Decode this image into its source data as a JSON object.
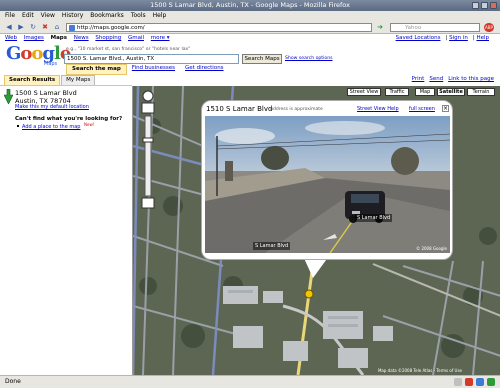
{
  "window": {
    "title": "1500 S Lamar Blvd, Austin, TX - Google Maps - Mozilla Firefox"
  },
  "menu": [
    "File",
    "Edit",
    "View",
    "History",
    "Bookmarks",
    "Tools",
    "Help"
  ],
  "browser": {
    "url": "http://maps.google.com/",
    "search_placeholder": "Yahoo",
    "status": "Done"
  },
  "gtoolbar": {
    "links": [
      "Web",
      "Images",
      "Maps",
      "News",
      "Shopping",
      "Gmail",
      "more ▾"
    ],
    "right": [
      "Saved Locations",
      "Sign in",
      "Help"
    ]
  },
  "logo": {
    "g1": "G",
    "o1": "o",
    "o2": "o",
    "g2": "g",
    "l": "l",
    "e": "e",
    "sub": "Maps"
  },
  "search": {
    "hint": "e.g., \"10 market st, san francisco\" or \"hotels near lax\"",
    "value": "1500 S. Lamar Blvd., Austin, TX",
    "button": "Search Maps",
    "options": "Show search options",
    "tabs": [
      "Search the map",
      "Find businesses",
      "Get directions"
    ]
  },
  "left_tabs": [
    "Search Results",
    "My Maps"
  ],
  "right_tools": [
    "Print",
    "Send",
    "Link to this page"
  ],
  "result": {
    "line1": "1500 S Lamar Blvd",
    "line2": "Austin, TX 78704",
    "default": "Make this my default location",
    "cant_find": "Can't find what you're looking for?",
    "add_place": "Add a place to the map",
    "new": "New!"
  },
  "map_buttons": [
    "Street View",
    "Traffic",
    "Map",
    "Satellite",
    "Terrain"
  ],
  "bubble": {
    "title": "1510 S Lamar Blvd",
    "subtitle": "Address is approximate",
    "streetview_help": "Street View Help",
    "fullscreen": "full screen",
    "street_label": "S Lamar Blvd",
    "street_label2": "S Lamar Blvd",
    "copyright": "© 2008 Google"
  },
  "map_copyright": "Map data ©2008 Tele Atlas - Terms of Use"
}
